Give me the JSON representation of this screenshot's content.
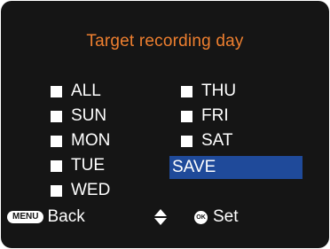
{
  "screen": {
    "title": "Target recording day"
  },
  "days": {
    "left": [
      {
        "label": "ALL",
        "checked": true
      },
      {
        "label": "SUN",
        "checked": true
      },
      {
        "label": "MON",
        "checked": true
      },
      {
        "label": "TUE",
        "checked": true
      },
      {
        "label": "WED",
        "checked": true
      }
    ],
    "right": [
      {
        "label": "THU",
        "checked": true
      },
      {
        "label": "FRI",
        "checked": true
      },
      {
        "label": "SAT",
        "checked": true
      }
    ]
  },
  "save": {
    "label": "SAVE",
    "selected": true
  },
  "footer": {
    "menu_key": "MENU",
    "back_label": "Back",
    "navigate_icon": "up-down-arrows-icon",
    "ok_key": "OK",
    "set_label": "Set"
  },
  "colors": {
    "background": "#151515",
    "title": "#ee7f2f",
    "text": "#ffffff",
    "highlight": "#1f4a9a"
  }
}
